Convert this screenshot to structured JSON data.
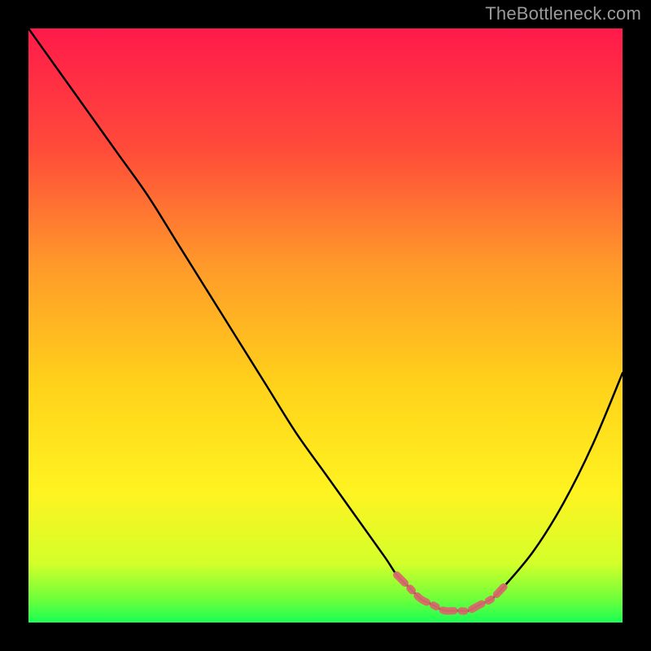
{
  "watermark": "TheBottleneck.com",
  "chart_data": {
    "type": "line",
    "title": "",
    "xlabel": "",
    "ylabel": "",
    "xlim": [
      0,
      100
    ],
    "ylim": [
      0,
      100
    ],
    "grid": false,
    "legend": false,
    "series": [
      {
        "name": "bottleneck-curve",
        "x": [
          0,
          5,
          10,
          15,
          20,
          25,
          30,
          35,
          40,
          45,
          50,
          55,
          60,
          62,
          64,
          66,
          68,
          70,
          72,
          74,
          76,
          78,
          80,
          85,
          90,
          95,
          100
        ],
        "values": [
          100,
          93,
          86,
          79,
          72,
          64,
          56,
          48,
          40,
          32,
          25,
          18,
          11,
          8,
          6,
          4,
          3,
          2,
          2,
          2,
          3,
          4,
          6,
          12,
          20,
          30,
          42
        ]
      },
      {
        "name": "optimal-band",
        "x": [
          62,
          64,
          66,
          68,
          70,
          72,
          74,
          76,
          78,
          80
        ],
        "values": [
          8,
          6,
          4,
          3,
          2,
          2,
          2,
          3,
          4,
          6
        ]
      }
    ],
    "gradient_stops": [
      {
        "offset": 0.0,
        "color": "#ff1a4b"
      },
      {
        "offset": 0.2,
        "color": "#ff4a3a"
      },
      {
        "offset": 0.4,
        "color": "#ff9a2a"
      },
      {
        "offset": 0.6,
        "color": "#ffd21a"
      },
      {
        "offset": 0.78,
        "color": "#fff321"
      },
      {
        "offset": 0.9,
        "color": "#d4ff2a"
      },
      {
        "offset": 0.96,
        "color": "#6fff3a"
      },
      {
        "offset": 1.0,
        "color": "#1aff55"
      }
    ],
    "colors": {
      "curve": "#000000",
      "band": "#d86a6a",
      "frame": "#000000"
    }
  }
}
